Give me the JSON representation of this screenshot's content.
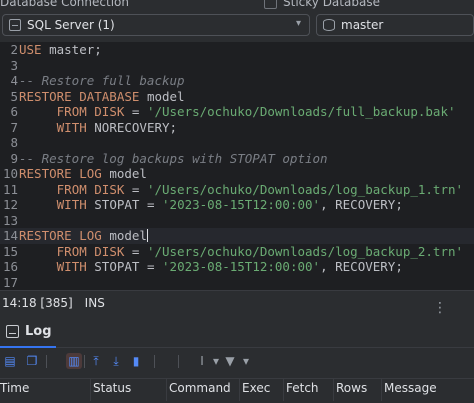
{
  "topbar": {
    "database_connection_label": "Database Connection",
    "sticky_label": "Sticky Database",
    "server_combo": "SQL Server (1)",
    "database_combo": "master"
  },
  "editor": {
    "lines": [
      {
        "n": "2",
        "tokens": [
          [
            "kw",
            "USE"
          ],
          [
            "txt",
            " master;"
          ]
        ]
      },
      {
        "n": "3",
        "tokens": []
      },
      {
        "n": "4",
        "tokens": [
          [
            "cmt",
            "-- Restore full backup"
          ]
        ]
      },
      {
        "n": "5",
        "tokens": [
          [
            "kw",
            "RESTORE DATABASE"
          ],
          [
            "txt",
            " model"
          ]
        ]
      },
      {
        "n": "6",
        "tokens": [
          [
            "txt",
            "     "
          ],
          [
            "kw",
            "FROM DISK"
          ],
          [
            "txt",
            " = "
          ],
          [
            "str",
            "'/Users/ochuko/Downloads/full_backup.bak'"
          ]
        ]
      },
      {
        "n": "7",
        "tokens": [
          [
            "txt",
            "     "
          ],
          [
            "kw",
            "WITH"
          ],
          [
            "txt",
            " NORECOVERY;"
          ]
        ]
      },
      {
        "n": "8",
        "tokens": []
      },
      {
        "n": "9",
        "tokens": [
          [
            "cmt",
            "-- Restore log backups with STOPAT option"
          ]
        ]
      },
      {
        "n": "10",
        "tokens": [
          [
            "kw",
            "RESTORE LOG"
          ],
          [
            "txt",
            " model"
          ]
        ]
      },
      {
        "n": "11",
        "tokens": [
          [
            "txt",
            "     "
          ],
          [
            "kw",
            "FROM DISK"
          ],
          [
            "txt",
            " = "
          ],
          [
            "str",
            "'/Users/ochuko/Downloads/log_backup_1.trn'"
          ]
        ]
      },
      {
        "n": "12",
        "tokens": [
          [
            "txt",
            "     "
          ],
          [
            "kw",
            "WITH"
          ],
          [
            "txt",
            " STOPAT = "
          ],
          [
            "str",
            "'2023-08-15T12:00:00'"
          ],
          [
            "txt",
            ", RECOVERY;"
          ]
        ]
      },
      {
        "n": "13",
        "tokens": []
      },
      {
        "n": "14",
        "tokens": [
          [
            "kw",
            "RESTORE LOG"
          ],
          [
            "txt",
            " model"
          ]
        ],
        "current": true
      },
      {
        "n": "15",
        "tokens": [
          [
            "txt",
            "     "
          ],
          [
            "kw",
            "FROM DISK"
          ],
          [
            "txt",
            " = "
          ],
          [
            "str",
            "'/Users/ochuko/Downloads/log_backup_2.trn'"
          ]
        ]
      },
      {
        "n": "16",
        "tokens": [
          [
            "txt",
            "     "
          ],
          [
            "kw",
            "WITH"
          ],
          [
            "txt",
            " STOPAT = "
          ],
          [
            "str",
            "'2023-08-15T12:00:00'"
          ],
          [
            "txt",
            ", RECOVERY;"
          ]
        ]
      },
      {
        "n": "17",
        "tokens": []
      }
    ]
  },
  "status": {
    "position": "14:18 [385]",
    "mode": "INS"
  },
  "panel": {
    "tab_label": "Log",
    "columns": [
      "Time",
      "Status",
      "Command",
      "Exec",
      "Fetch",
      "Rows",
      "Message"
    ]
  },
  "colors": {
    "keyword": "#cf8e6d",
    "string": "#6aab73",
    "comment": "#7a7e85",
    "accent": "#3574f0"
  }
}
